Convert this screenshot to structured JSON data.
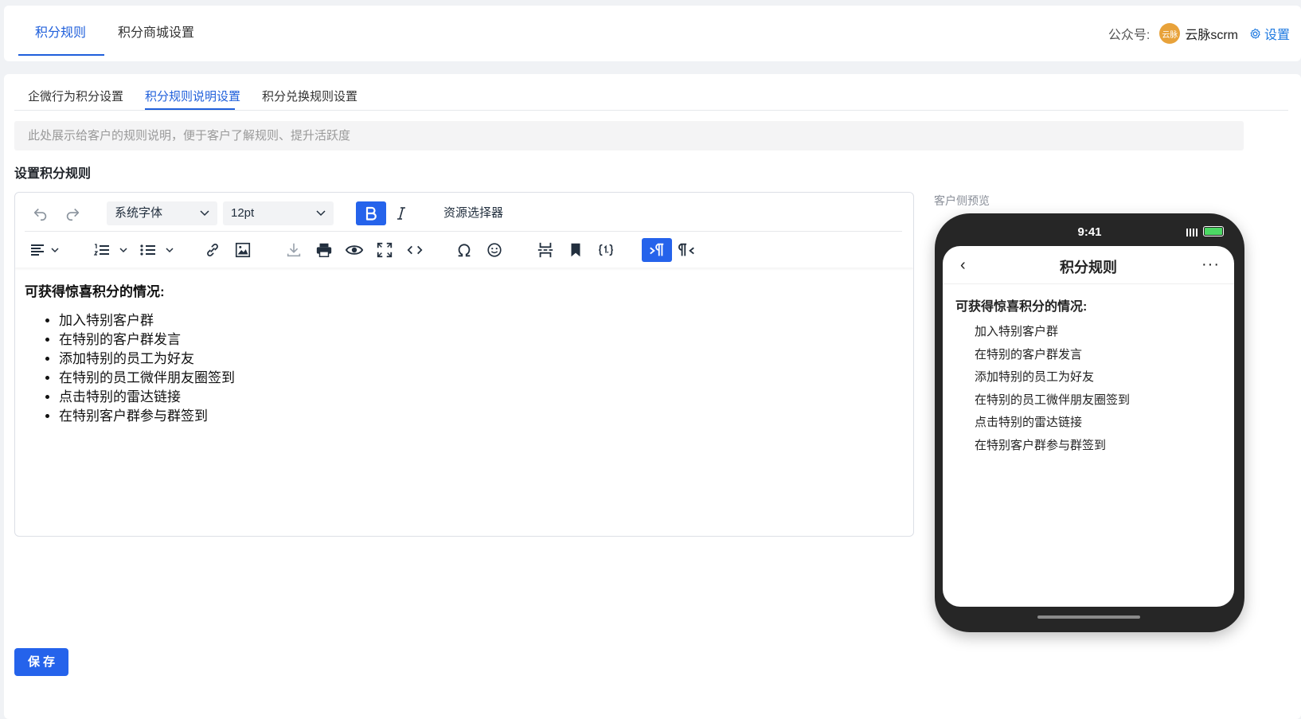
{
  "header": {
    "tabs": [
      {
        "label": "积分规则",
        "active": true
      },
      {
        "label": "积分商城设置",
        "active": false
      }
    ],
    "account_label": "公众号:",
    "avatar_text": "云脉",
    "account_name": "云脉scrm",
    "settings_label": "设置"
  },
  "subtabs": [
    {
      "label": "企微行为积分设置",
      "active": false
    },
    {
      "label": "积分规则说明设置",
      "active": true
    },
    {
      "label": "积分兑换规则设置",
      "active": false
    }
  ],
  "notice": "此处展示给客户的规则说明，便于客户了解规则、提升活跃度",
  "section_title": "设置积分规则",
  "toolbar": {
    "font_family": "系统字体",
    "font_size": "12pt",
    "resource_selector": "资源选择器"
  },
  "content": {
    "heading": "可获得惊喜积分的情况:",
    "items": [
      "加入特别客户群",
      "在特别的客户群发言",
      "添加特别的员工为好友",
      "在特别的员工微伴朋友圈签到",
      "点击特别的雷达链接",
      "在特别客户群参与群签到"
    ]
  },
  "preview": {
    "label": "客户侧预览",
    "time": "9:41",
    "title": "积分规则",
    "heading": "可获得惊喜积分的情况:",
    "items": [
      "加入特别客户群",
      "在特别的客户群发言",
      "添加特别的员工为好友",
      "在特别的员工微伴朋友圈签到",
      "点击特别的雷达链接",
      "在特别客户群参与群签到"
    ]
  },
  "save_label": "保存",
  "colors": {
    "accent": "#1f5fdb",
    "button": "#2563eb",
    "link": "#1f7ae0",
    "phone": "#262626"
  }
}
